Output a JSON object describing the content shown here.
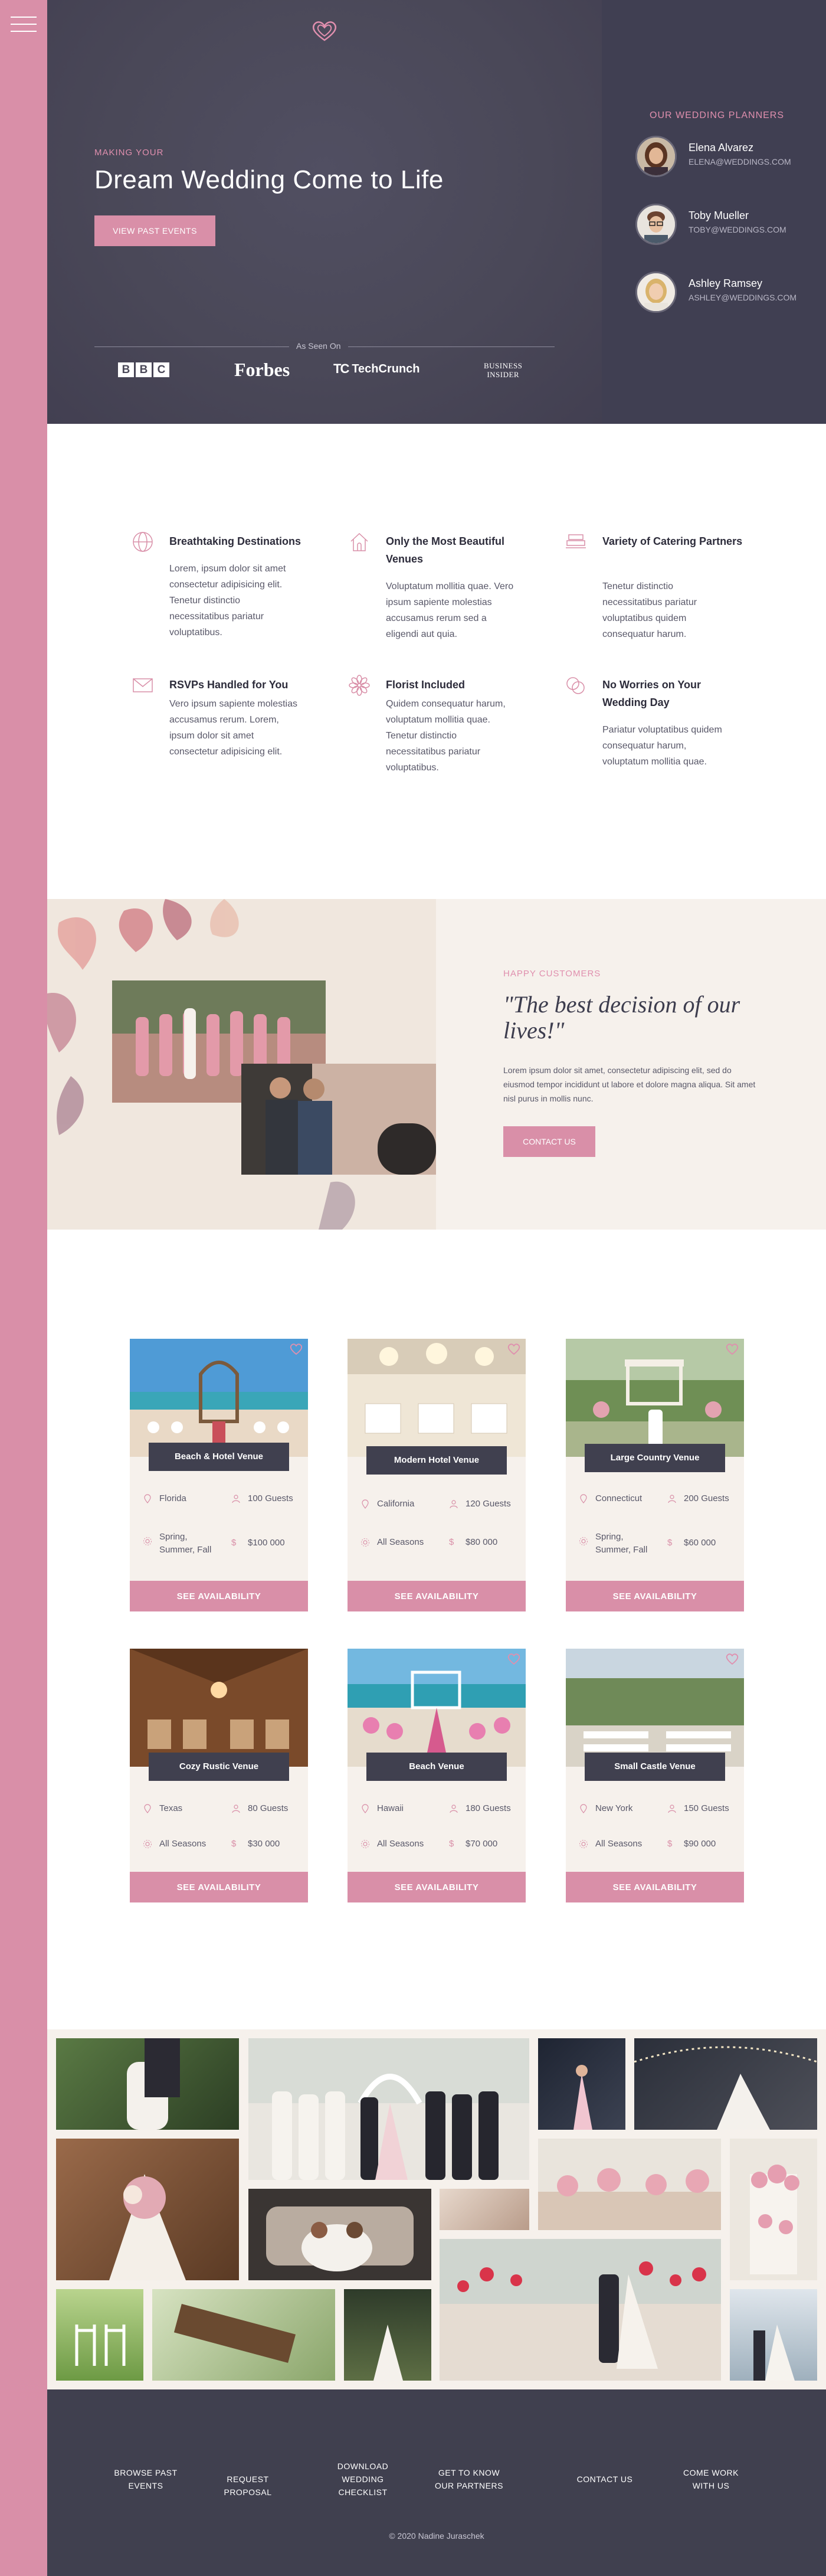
{
  "hero": {
    "eyebrow": "MAKING YOUR",
    "title": "Dream Wedding Come to Life",
    "cta": "VIEW PAST EVENTS",
    "as_seen_on": "As Seen On",
    "press": {
      "bbc": [
        "B",
        "B",
        "C"
      ],
      "forbes": "Forbes",
      "techcrunch_mark": "TC",
      "techcrunch": "TechCrunch",
      "business_insider": [
        "BUSINESS",
        "INSIDER"
      ]
    }
  },
  "planners": {
    "title": "OUR WEDDING PLANNERS",
    "people": [
      {
        "name": "Elena Alvarez",
        "email": "ELENA@WEDDINGS.COM"
      },
      {
        "name": "Toby Mueller",
        "email": "TOBY@WEDDINGS.COM"
      },
      {
        "name": "Ashley Ramsey",
        "email": "ASHLEY@WEDDINGS.COM"
      }
    ]
  },
  "features": [
    {
      "icon": "globe-icon",
      "title": "Breathtaking Destinations",
      "text": "Lorem, ipsum dolor sit amet consectetur adipisicing elit. Tenetur distinctio necessitatibus pariatur voluptatibus."
    },
    {
      "icon": "house-icon",
      "title": "Only the Most Beautiful Venues",
      "text": "Voluptatum mollitia quae. Vero ipsum sapiente molestias accusamus rerum sed a eligendi aut quia."
    },
    {
      "icon": "catering-icon",
      "title": "Variety of Catering Partners",
      "text": "Tenetur distinctio necessitatibus pariatur voluptatibus quidem consequatur harum."
    },
    {
      "icon": "envelope-icon",
      "title": "RSVPs Handled for You",
      "text": "Vero ipsum sapiente molestias accusamus rerum. Lorem, ipsum dolor sit amet consectetur adipisicing elit."
    },
    {
      "icon": "flower-icon",
      "title": "Florist Included",
      "text": "Quidem consequatur harum, voluptatum mollitia quae. Tenetur distinctio necessitatibus pariatur voluptatibus."
    },
    {
      "icon": "rings-icon",
      "title": "No Worries on Your Wedding Day",
      "text": "Pariatur voluptatibus quidem consequatur harum, voluptatum mollitia quae."
    }
  ],
  "testimonial": {
    "eyebrow": "HAPPY CUSTOMERS",
    "quote": "\"The best decision of our lives!\"",
    "text": "Lorem ipsum dolor sit amet, consectetur adipiscing elit, sed do eiusmod tempor incididunt ut labore et dolore magna aliqua. Sit amet nisl purus in mollis nunc.",
    "cta": "CONTACT US"
  },
  "venues": [
    {
      "name": "Beach & Hotel Venue",
      "location": "Florida",
      "guests": "100 Guests",
      "season": "Spring, Summer, Fall",
      "price": "$100 000",
      "cta": "SEE AVAILABILITY"
    },
    {
      "name": "Modern Hotel Venue",
      "location": "California",
      "guests": "120 Guests",
      "season": "All Seasons",
      "price": "$80 000",
      "cta": "SEE AVAILABILITY"
    },
    {
      "name": "Large Country Venue",
      "location": "Connecticut",
      "guests": "200 Guests",
      "season": "Spring, Summer, Fall",
      "price": "$60 000",
      "cta": "SEE AVAILABILITY"
    },
    {
      "name": "Cozy Rustic Venue",
      "location": "Texas",
      "guests": "80 Guests",
      "season": "All Seasons",
      "price": "$30 000",
      "cta": "SEE AVAILABILITY"
    },
    {
      "name": "Beach Venue",
      "location": "Hawaii",
      "guests": "180 Guests",
      "season": "All Seasons",
      "price": "$70 000",
      "cta": "SEE AVAILABILITY"
    },
    {
      "name": "Small Castle Venue",
      "location": "New York",
      "guests": "150 Guests",
      "season": "All Seasons",
      "price": "$90 000",
      "cta": "SEE AVAILABILITY"
    }
  ],
  "footer": {
    "links": [
      "BROWSE PAST EVENTS",
      "REQUEST PROPOSAL",
      "DOWNLOAD WEDDING CHECKLIST",
      "GET TO KNOW OUR PARTNERS",
      "CONTACT US",
      "COME WORK WITH US"
    ],
    "copyright": "© 2020 Nadine Juraschek"
  },
  "colors": {
    "accent": "#d98fa8",
    "dark": "#40404f",
    "cream": "#f6f1ec"
  }
}
